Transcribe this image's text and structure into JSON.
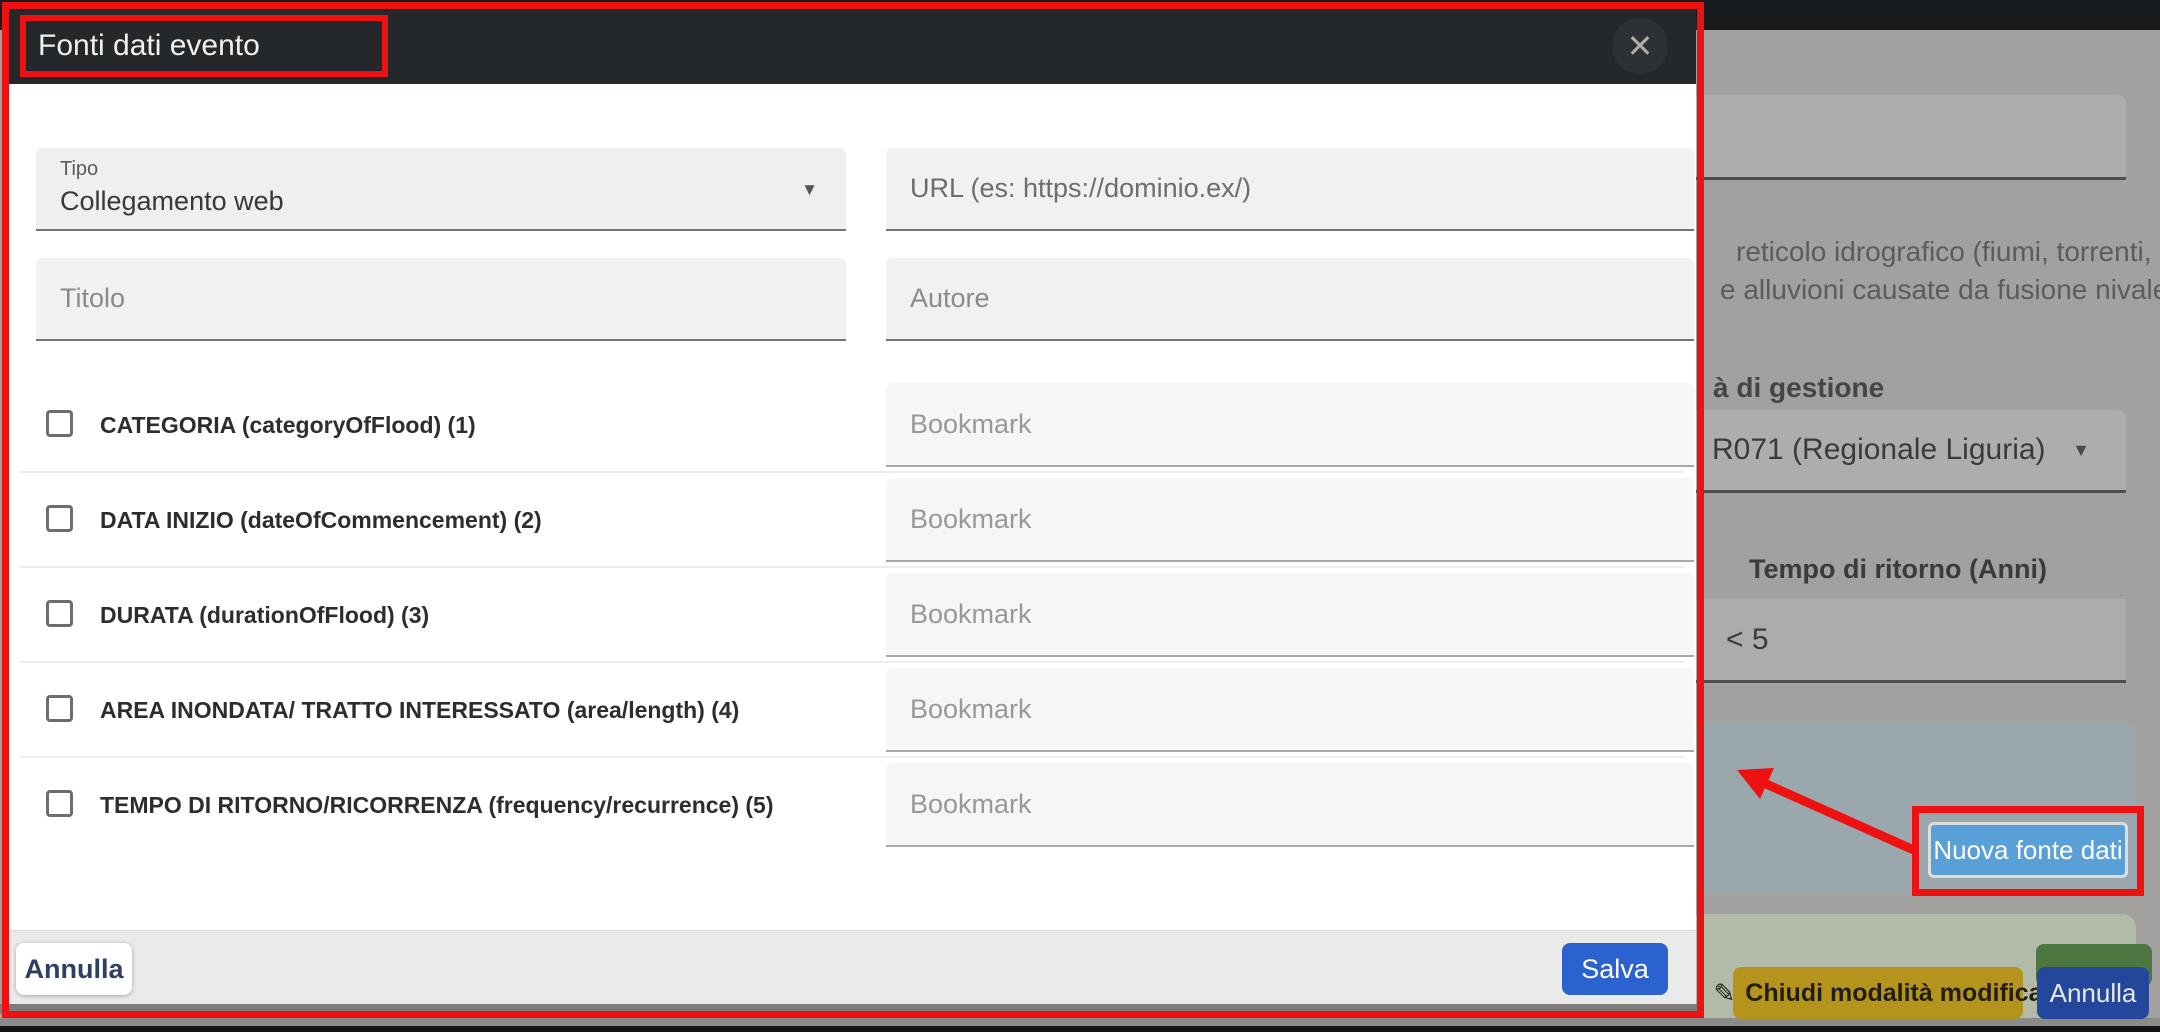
{
  "icons": {
    "close": "✕",
    "dropdown": "▼",
    "edit": "✎"
  },
  "modal": {
    "title": "Fonti dati evento",
    "tipo_label": "Tipo",
    "tipo_value": "Collegamento web",
    "url_placeholder": "URL (es: https://dominio.ex/)",
    "titolo_placeholder": "Titolo",
    "autore_placeholder": "Autore",
    "rows": [
      {
        "label": "CATEGORIA (categoryOfFlood) (1)",
        "bookmark_placeholder": "Bookmark",
        "checked": false
      },
      {
        "label": "DATA INIZIO (dateOfCommencement) (2)",
        "bookmark_placeholder": "Bookmark",
        "checked": false
      },
      {
        "label": "DURATA (durationOfFlood) (3)",
        "bookmark_placeholder": "Bookmark",
        "checked": false
      },
      {
        "label": "AREA INONDATA/ TRATTO INTERESSATO (area/length) (4)",
        "bookmark_placeholder": "Bookmark",
        "checked": false
      },
      {
        "label": "TEMPO DI RITORNO/RICORRENZA (frequency/recurrence) (5)",
        "bookmark_placeholder": "Bookmark",
        "checked": false
      }
    ],
    "cancel_label": "Annulla",
    "save_label": "Salva"
  },
  "background_page": {
    "description_line1": "reticolo idrografico (fiumi, torrenti,",
    "description_line2": "e alluvioni causate da fusione nivale)",
    "gestione_label": "à di gestione",
    "gestione_value": "R071 (Regionale Liguria)",
    "tempo_ritorno_label": "Tempo di ritorno (Anni)",
    "tempo_ritorno_value": "< 5",
    "nuova_fonte_label": "Nuova fonte dati",
    "chiudi_modifica_label": "Chiudi modalità modifica",
    "annulla_label": "Annulla"
  },
  "colors": {
    "annotation_red": "#ee1111",
    "modal_header": "#25282b",
    "save_blue": "#2c61d0",
    "nuova_fonte_blue": "#5aa0d8",
    "chiudi_yellow": "#b5941e",
    "annulla_blue": "#24479c",
    "green_button": "#4c7540",
    "dim_overlay_gray": "#a2a19f"
  }
}
